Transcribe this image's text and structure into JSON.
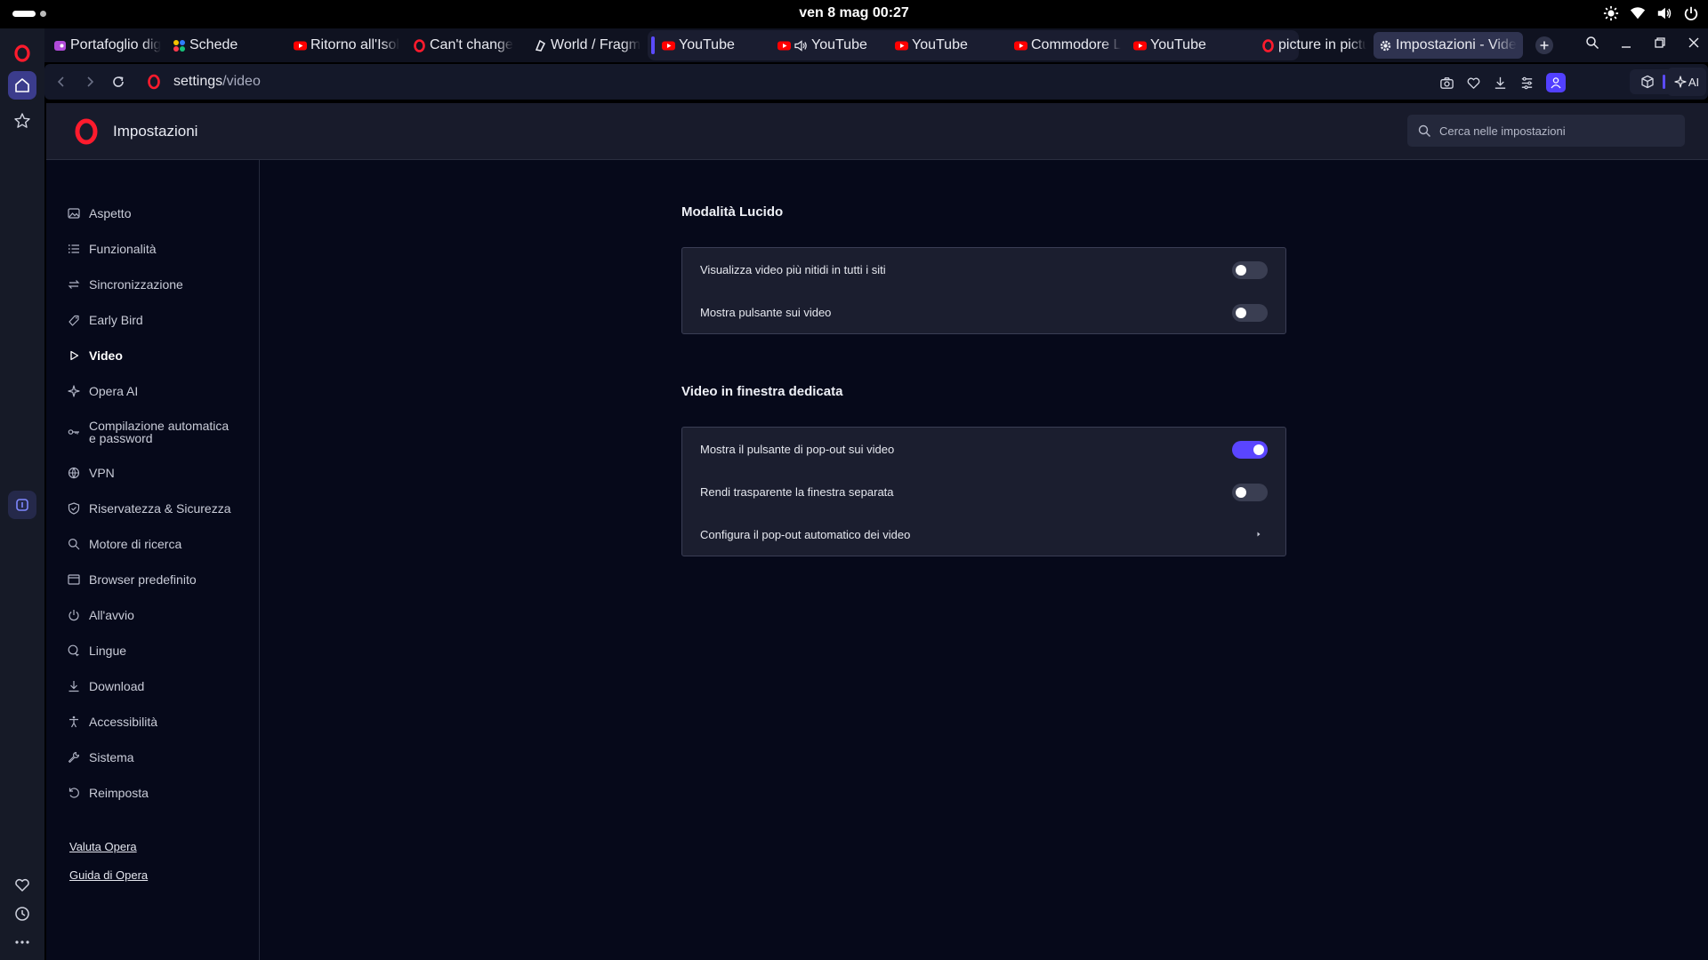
{
  "system_bar": {
    "clock": "ven 8 mag  00:27"
  },
  "tabs": [
    {
      "title": "Portafoglio dig",
      "icon": "wallet-favicon"
    },
    {
      "title": "Schede",
      "icon": "tabs-favicon"
    },
    {
      "title": "Ritorno all'Isol",
      "icon": "youtube-favicon"
    },
    {
      "title": "Can't change",
      "icon": "opera-favicon"
    },
    {
      "title": "World / Fragm",
      "icon": "fragment-favicon"
    },
    {
      "title": "YouTube",
      "icon": "youtube-favicon"
    },
    {
      "title": "YouTube",
      "icon": "youtube-favicon"
    },
    {
      "title": "YouTube",
      "icon": "youtube-favicon"
    },
    {
      "title": "Commodore L",
      "icon": "youtube-favicon"
    },
    {
      "title": "YouTube",
      "icon": "youtube-favicon"
    },
    {
      "title": "picture in pictu",
      "icon": "opera-favicon"
    },
    {
      "title": "Impostazioni - Vide",
      "icon": "gear-favicon"
    }
  ],
  "address_bar": {
    "url_host": "settings",
    "url_path": "/video"
  },
  "header": {
    "title": "Impostazioni",
    "search_placeholder": "Cerca nelle impostazioni"
  },
  "nav": {
    "items": [
      {
        "label": "Aspetto",
        "icon": "image-icon"
      },
      {
        "label": "Funzionalità",
        "icon": "list-icon"
      },
      {
        "label": "Sincronizzazione",
        "icon": "sync-icon"
      },
      {
        "label": "Early Bird",
        "icon": "early-bird-icon"
      },
      {
        "label": "Video",
        "icon": "play-icon",
        "active": true
      },
      {
        "label": "Opera AI",
        "icon": "sparkle-icon"
      },
      {
        "label_1": "Compilazione automatica",
        "label_2": "e password",
        "icon": "key-icon"
      },
      {
        "label": "VPN",
        "icon": "vpn-icon"
      },
      {
        "label": "Riservatezza & Sicurezza",
        "icon": "shield-icon"
      },
      {
        "label": "Motore di ricerca",
        "icon": "search-icon"
      },
      {
        "label": "Browser predefinito",
        "icon": "window-icon"
      },
      {
        "label": "All'avvio",
        "icon": "power-icon"
      },
      {
        "label": "Lingue",
        "icon": "language-icon"
      },
      {
        "label": "Download",
        "icon": "download-icon"
      },
      {
        "label": "Accessibilità",
        "icon": "accessibility-icon"
      },
      {
        "label": "Sistema",
        "icon": "wrench-icon"
      },
      {
        "label": "Reimposta",
        "icon": "reset-icon"
      }
    ],
    "footer_links": [
      "Valuta Opera",
      "Guida di Opera"
    ]
  },
  "sections": [
    {
      "title": "Modalità Lucido",
      "rows": [
        {
          "label": "Visualizza video più nitidi in tutti i siti",
          "type": "toggle",
          "on": false
        },
        {
          "label": "Mostra pulsante sui video",
          "type": "toggle",
          "on": false
        }
      ]
    },
    {
      "title": "Video in finestra dedicata",
      "rows": [
        {
          "label": "Mostra il pulsante di pop-out sui video",
          "type": "toggle",
          "on": true
        },
        {
          "label": "Rendi trasparente la finestra separata",
          "type": "toggle",
          "on": false
        },
        {
          "label": "Configura il pop-out automatico dei video",
          "type": "link"
        }
      ]
    }
  ],
  "extras": {
    "ai_label": "AI"
  },
  "colors": {
    "accent": "#5a45ff",
    "background": "#06091a",
    "card": "#1b1e2f",
    "opera_red": "#ff1b2d",
    "youtube_red": "#ff0000"
  }
}
